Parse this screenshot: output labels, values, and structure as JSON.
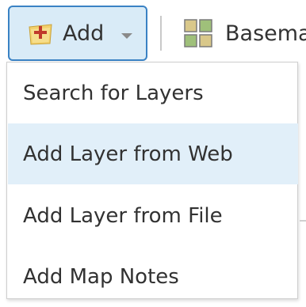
{
  "toolbar": {
    "add_label": "Add",
    "add_icon": "add-layer-icon",
    "caret_icon": "chevron-down-icon",
    "basemap_label": "Basema",
    "basemap_icon": "basemap-gallery-icon",
    "accent_color": "#3a82c4"
  },
  "menu": {
    "items": [
      {
        "label": "Search for Layers"
      },
      {
        "label": "Add Layer from Web"
      },
      {
        "label": "Add Layer from File"
      },
      {
        "label": "Add Map Notes"
      }
    ],
    "highlight_color": "#e1eff9"
  }
}
